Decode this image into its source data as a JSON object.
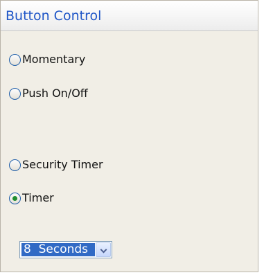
{
  "header": {
    "title": "Button Control"
  },
  "options": [
    {
      "label": "Momentary",
      "checked": false
    },
    {
      "label": "Push On/Off",
      "checked": false
    },
    {
      "label": "Security Timer",
      "checked": false
    },
    {
      "label": "Timer",
      "checked": true
    }
  ],
  "timer_select": {
    "value": "8  Seconds"
  },
  "colors": {
    "title": "#1f56c7",
    "selection": "#316ac5",
    "radio_border": "#1f5ea8",
    "radio_checked": "#1f8d30"
  }
}
